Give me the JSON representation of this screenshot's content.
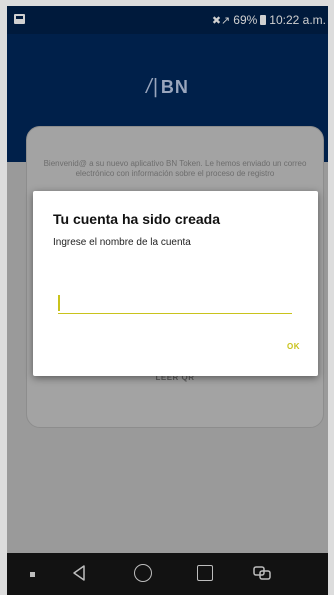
{
  "status_bar": {
    "battery_text": "69%",
    "time": "10:22 a.m.",
    "signal_glyph": "✖↗"
  },
  "app": {
    "logo_text": "BN",
    "logo_mark": "/|",
    "card_text": "Bienvenid@ a su nuevo aplicativo BN Token. Le hemos enviado un correo electrónico con información sobre el proceso de registro",
    "card_link": "LEER QR"
  },
  "dialog": {
    "title": "Tu cuenta ha sido creada",
    "subtitle": "Ingrese el nombre de la cuenta",
    "input_value": "",
    "ok_label": "OK"
  },
  "colors": {
    "header": "#00204a",
    "accent": "#c9c31c"
  }
}
